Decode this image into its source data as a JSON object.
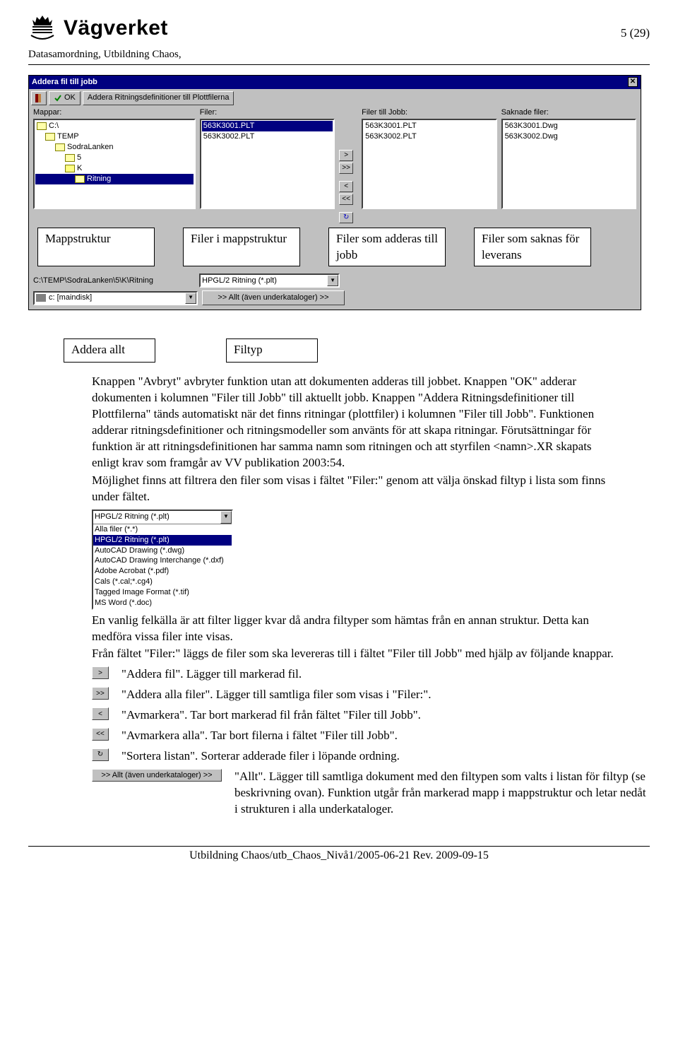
{
  "header": {
    "wordmark": "Vägverket",
    "page_number": "5 (29)",
    "subhead": "Datasamordning, Utbildning Chaos,"
  },
  "dialog": {
    "title": "Addera fil till jobb",
    "ok_label": "OK",
    "addera_label": "Addera Ritningsdefinitioner till Plottfilerna",
    "columns": {
      "mappar": "Mappar:",
      "filer": "Filer:",
      "filer_till_jobb": "Filer till Jobb:",
      "saknade": "Saknade filer:"
    },
    "tree": [
      {
        "label": "C:\\",
        "indent": 0,
        "open": true
      },
      {
        "label": "TEMP",
        "indent": 1,
        "open": true
      },
      {
        "label": "SodraLanken",
        "indent": 2,
        "open": true
      },
      {
        "label": "5",
        "indent": 3,
        "open": true
      },
      {
        "label": "K",
        "indent": 3,
        "open": false
      },
      {
        "label": "Ritning",
        "indent": 4,
        "open": true,
        "selected": true
      }
    ],
    "filer": [
      "563K3001.PLT",
      "563K3002.PLT"
    ],
    "filer_sel": 0,
    "filer_jobb": [
      "563K3001.PLT",
      "563K3002.PLT"
    ],
    "saknade": [
      "563K3001.Dwg",
      "563K3002.Dwg"
    ],
    "bottom": {
      "path": "C:\\TEMP\\SodraLanken\\5\\K\\Ritning",
      "drive": "c: [maindisk]",
      "filetype": "HPGL/2 Ritning (*.plt)",
      "all_label": ">> Allt (även underkataloger) >>"
    }
  },
  "callouts": {
    "c1": "Mappstruktur",
    "c2": "Filer i mappstruktur",
    "c3": "Filer som adderas till jobb",
    "c4": "Filer som saknas för leverans",
    "c5": "Addera allt",
    "c6": "Filtyp"
  },
  "paragraph1": "Knappen \"Avbryt\" avbryter funktion utan att dokumenten adderas till jobbet. Knappen \"OK\" adderar dokumenten i kolumnen \"Filer till Jobb\" till aktuellt jobb. Knappen \"Addera Ritningsdefinitioner till Plottfilerna\" tänds automatiskt när det finns ritningar (plottfiler) i kolumnen \"Filer till Jobb\". Funktionen adderar ritningsdefinitioner och ritningsmodeller som använts för att skapa ritningar. Förutsättningar för funktion är att ritningsdefinitionen har samma namn som ritningen och att styrfilen <namn>.XR skapats enligt krav som framgår av VV publikation 2003:54.",
  "paragraph1b": "Möjlighet finns att filtrera den filer som visas i fältet \"Filer:\" genom att välja önskad filtyp i lista som finns under fältet.",
  "filter_options": {
    "selected": "HPGL/2 Ritning (*.plt)",
    "list": [
      "Alla filer (*.*)",
      "HPGL/2 Ritning (*.plt)",
      "AutoCAD Drawing (*.dwg)",
      "AutoCAD Drawing Interchange (*.dxf)",
      "Adobe Acrobat (*.pdf)",
      "Cals (*.cal;*.cg4)",
      "Tagged Image Format (*.tif)",
      "MS Word (*.doc)"
    ],
    "sel_index": 1
  },
  "paragraph2a": "En vanlig felkälla är att filter ligger kvar då andra filtyper som hämtas från en annan struktur. Detta kan medföra vissa filer inte visas.",
  "paragraph2b": "Från fältet \"Filer:\" läggs de filer som ska levereras till i fältet \"Filer till Jobb\" med hjälp av följande knappar.",
  "buttons": [
    {
      "icon": ">",
      "desc": "\"Addera fil\". Lägger till markerad fil."
    },
    {
      "icon": ">>",
      "desc": "\"Addera alla filer\". Lägger till samtliga filer som visas i \"Filer:\"."
    },
    {
      "icon": "<",
      "desc": "\"Avmarkera\". Tar bort markerad fil från fältet \"Filer till Jobb\"."
    },
    {
      "icon": "<<",
      "desc": "\"Avmarkera alla\". Tar bort filerna i fältet \"Filer till Jobb\"."
    },
    {
      "icon": "↻",
      "desc": "\"Sortera listan\". Sorterar adderade filer i löpande ordning."
    },
    {
      "icon": ">> Allt (även underkataloger) >>",
      "wide": true,
      "desc": "\"Allt\". Lägger till samtliga dokument med den filtypen som valts i listan för filtyp (se beskrivning ovan). Funktion utgår från markerad mapp i mappstruktur och letar nedåt i strukturen i alla underkataloger."
    }
  ],
  "footer": "Utbildning Chaos/utb_Chaos_Nivå1/2005-06-21 Rev. 2009-09-15"
}
